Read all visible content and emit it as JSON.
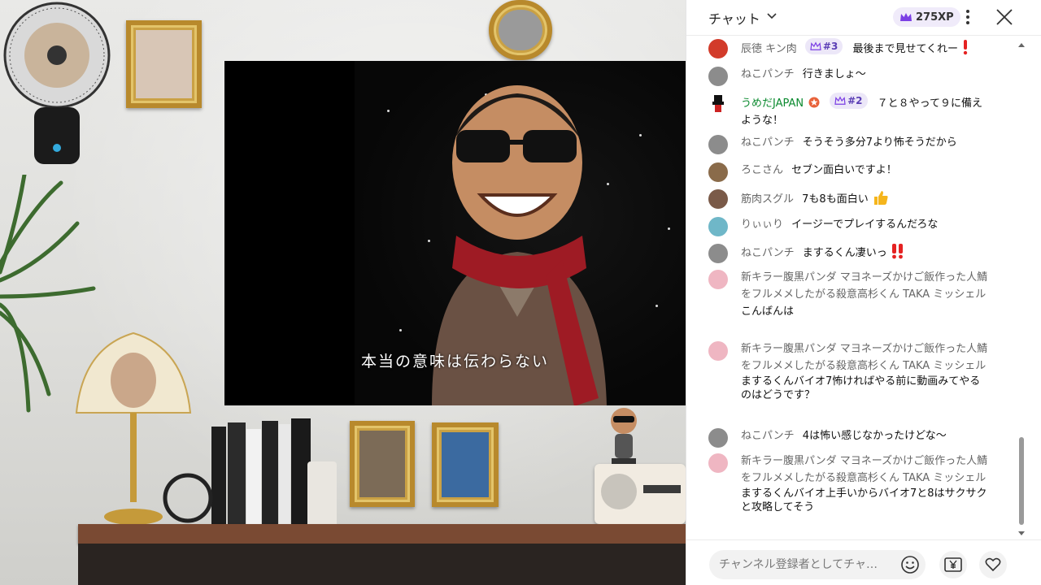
{
  "stream": {
    "subtitle": "本当の意味は伝わらない"
  },
  "chat": {
    "title": "チャット",
    "xp": "275XP",
    "input_placeholder": "チャンネル登録者としてチャ…",
    "colors": {
      "accent": "#7b3fe4",
      "author_green": "#0b8a2f",
      "badge_bg": "#ece7f8"
    },
    "messages": [
      {
        "author": "辰徳 キン肉",
        "rank": "#3",
        "text": "最後まで見せてくれー",
        "emoji": "exclamation-icon",
        "avatar_color": "#d23b2a"
      },
      {
        "author": "ねこパンチ",
        "text": "行きましょ～",
        "avatar_color": "#8c8c8c"
      },
      {
        "author": "うめだJAPAN",
        "rank": "#2",
        "text": "７と８やって９に備えような！",
        "avatar_color": "#222222",
        "verified_icon": "star-badge-icon"
      },
      {
        "author": "ねこパンチ",
        "text": "そうそう多分7より怖そうだから",
        "avatar_color": "#8c8c8c"
      },
      {
        "author": "ろこさん",
        "text": "セブン面白いですよ！",
        "avatar_color": "#8a6b4a"
      },
      {
        "author": "筋肉スグル",
        "text": "7も8も面白い",
        "emoji": "thumbs-up-icon",
        "avatar_color": "#7a5a48"
      },
      {
        "author": "りぃぃり",
        "text": "イージーでプレイするんだろな",
        "avatar_color": "#6fb7c8"
      },
      {
        "author": "ねこパンチ",
        "text": "まするくん凄いっ",
        "emoji": "double-exclamation-icon",
        "avatar_color": "#8c8c8c"
      },
      {
        "author": "新キラー腹黒パンダ マヨネーズかけご飯作った人鯖をフルメメしたがる殺意高杉くん TAKA ミッシェル",
        "text": "こんばんは",
        "avatar_color": "#efb6c2"
      },
      {
        "author": "新キラー腹黒パンダ マヨネーズかけご飯作った人鯖をフルメメしたがる殺意高杉くん TAKA ミッシェル",
        "text": "まするくんバイオ7怖ければやる前に動画みてやるのはどうです？",
        "avatar_color": "#efb6c2"
      },
      {
        "author": "ねこパンチ",
        "text": "4は怖い感じなかったけどな～",
        "avatar_color": "#8c8c8c"
      },
      {
        "author": "新キラー腹黒パンダ マヨネーズかけご飯作った人鯖をフルメメしたがる殺意高杉くん TAKA ミッシェル",
        "text": "まするくんバイオ上手いからバイオ7と8はサクサクと攻略してそう",
        "avatar_color": "#efb6c2"
      }
    ]
  }
}
